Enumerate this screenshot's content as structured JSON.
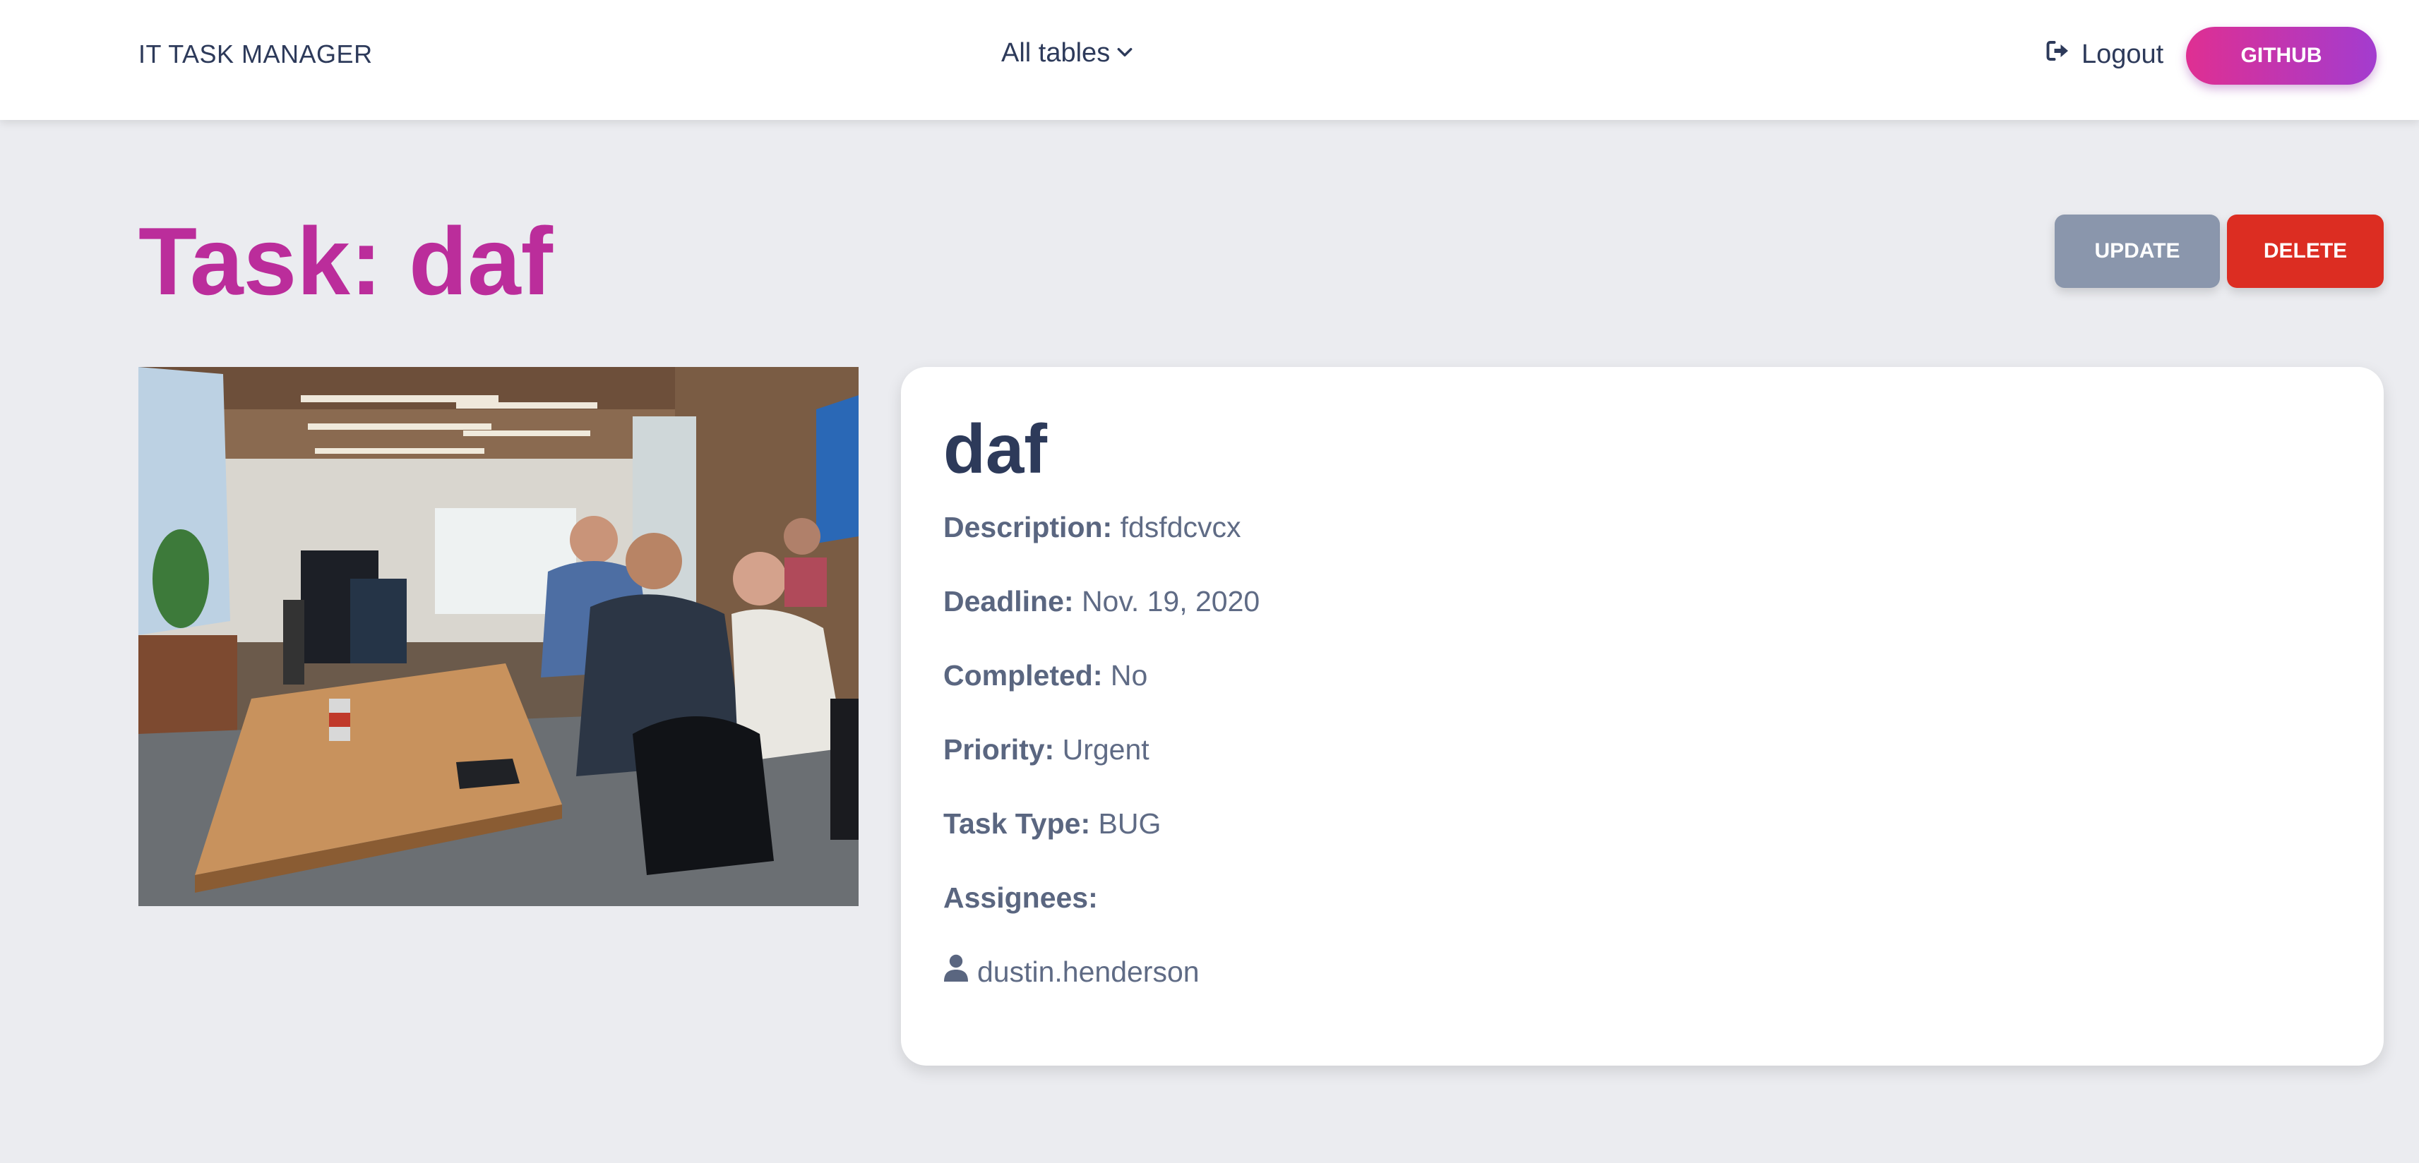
{
  "navbar": {
    "brand": "IT TASK MANAGER",
    "dropdown_label": "All tables",
    "dropdown_icon": "chevron-down-icon",
    "logout_label": "Logout",
    "logout_icon": "sign-out-icon",
    "github_label": "GITHUB"
  },
  "page": {
    "title": "Task: daf",
    "update_label": "UPDATE",
    "delete_label": "DELETE"
  },
  "task": {
    "name": "daf",
    "fields": [
      {
        "label": "Description:",
        "value": "fdsfdcvcx"
      },
      {
        "label": "Deadline:",
        "value": "Nov. 19, 2020"
      },
      {
        "label": "Completed:",
        "value": "No"
      },
      {
        "label": "Priority:",
        "value": "Urgent"
      },
      {
        "label": "Task Type:",
        "value": "BUG"
      },
      {
        "label": "Assignees:",
        "value": ""
      }
    ],
    "assignees": [
      {
        "username": "dustin.henderson",
        "icon": "user-icon"
      }
    ]
  },
  "colors": {
    "title": "#bb2d9b",
    "github_gradient_start": "#df2f92",
    "github_gradient_end": "#a33ccf",
    "update": "#8a96ac",
    "delete": "#dc2d22",
    "background": "#ebecf0"
  }
}
